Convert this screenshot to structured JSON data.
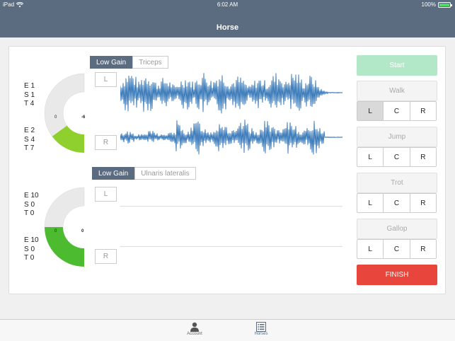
{
  "status_bar": {
    "device": "iPad",
    "time": "6:02 AM",
    "battery": "100%",
    "battery_level": 1.0
  },
  "nav": {
    "title": "Horse"
  },
  "top_panel": {
    "gain_label": "Low Gain",
    "muscle": "Triceps",
    "left_stats": [
      "E 1",
      "S 1",
      "T 4"
    ],
    "right_stats": [
      "E 2",
      "S 4",
      "T 7"
    ],
    "gauge": {
      "min_label": "0",
      "value_label": "-6",
      "fill_fraction": 0.3,
      "fill_color": "#8fcf2e"
    },
    "left_button": "L",
    "right_button": "R"
  },
  "bottom_panel": {
    "gain_label": "Low Gain",
    "muscle": "Ulnaris lateralis",
    "left_stats": [
      "E 10",
      "S 0",
      "T 0"
    ],
    "right_stats": [
      "E 10",
      "S 0",
      "T 0"
    ],
    "gauge": {
      "min_label": "0",
      "value_label": "0",
      "fill_fraction": 0.5,
      "fill_color": "#4cbb2f"
    },
    "left_button": "L",
    "right_button": "R"
  },
  "controls": {
    "start": "Start",
    "finish": "FINISH",
    "gaits": [
      {
        "label": "Walk",
        "options": [
          "L",
          "C",
          "R"
        ],
        "selected": "L"
      },
      {
        "label": "Jump",
        "options": [
          "L",
          "C",
          "R"
        ],
        "selected": ""
      },
      {
        "label": "Trot",
        "options": [
          "L",
          "C",
          "R"
        ],
        "selected": ""
      },
      {
        "label": "Gallop",
        "options": [
          "L",
          "C",
          "R"
        ],
        "selected": ""
      }
    ]
  },
  "tabs": [
    {
      "label": "Account",
      "icon": "person-icon"
    },
    {
      "label": "Horses",
      "icon": "list-icon"
    }
  ],
  "colors": {
    "nav": "#5b6b80",
    "wave": "#2f73b5",
    "start": "#b2e8c7",
    "finish": "#e8453c"
  }
}
